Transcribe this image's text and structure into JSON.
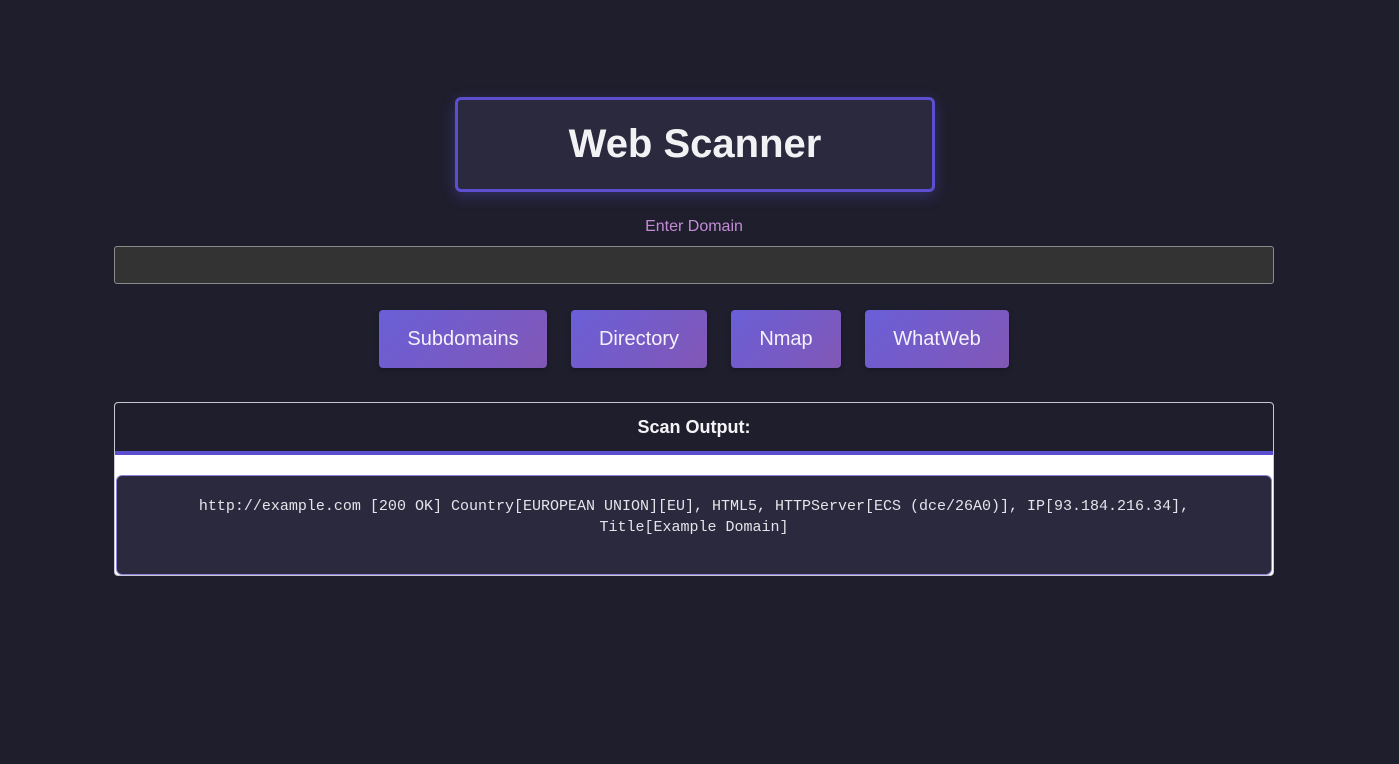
{
  "header": {
    "title": "Web Scanner"
  },
  "form": {
    "domain_label": "Enter Domain",
    "domain_value": "",
    "domain_placeholder": ""
  },
  "actions": {
    "subdomains_label": "Subdomains",
    "directory_label": "Directory",
    "nmap_label": "Nmap",
    "whatweb_label": "WhatWeb"
  },
  "output": {
    "heading": "Scan Output:",
    "text": "http://example.com [200 OK] Country[EUROPEAN UNION][EU], HTML5, HTTPServer[ECS (dce/26A0)], IP[93.184.216.34], Title[Example Domain]"
  },
  "colors": {
    "background": "#1f1e2d",
    "accent": "#5b4fd0",
    "label": "#c28bd6",
    "button_gradient_start": "#6a5fd8",
    "button_gradient_end": "#8257b5"
  }
}
